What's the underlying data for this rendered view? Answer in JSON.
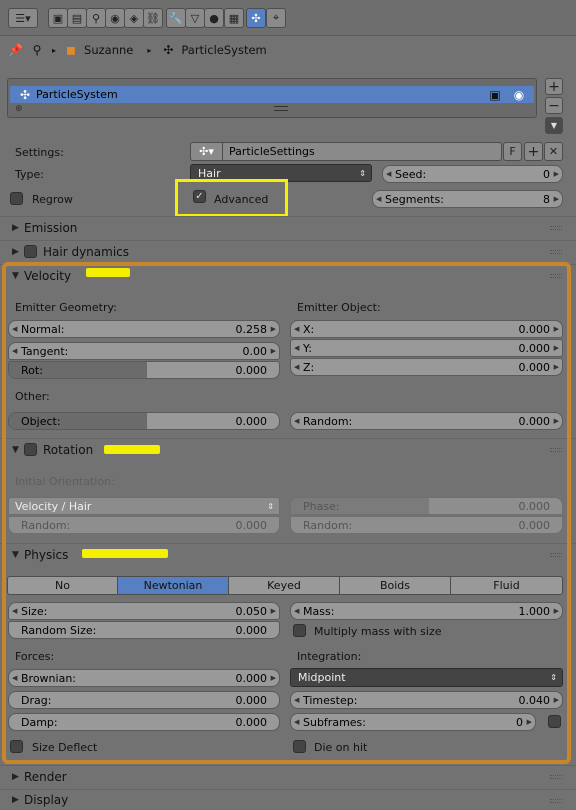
{
  "breadcrumb": {
    "object": "Suzanne",
    "particles": "ParticleSystem"
  },
  "list": {
    "item": "ParticleSystem",
    "add_symbol": "+",
    "remove_symbol": "−",
    "down_symbol": "▼"
  },
  "settings": {
    "label": "Settings:",
    "name": "ParticleSettings",
    "fake_user": "F",
    "type_label": "Type:",
    "type_value": "Hair",
    "seed_label": "Seed:",
    "seed_value": "0",
    "regrow_label": "Regrow",
    "advanced_label": "Advanced",
    "segments_label": "Segments:",
    "segments_value": "8"
  },
  "sections": {
    "emission": "Emission",
    "hair_dynamics": "Hair dynamics",
    "velocity": "Velocity",
    "rotation": "Rotation",
    "physics": "Physics",
    "render": "Render",
    "display": "Display"
  },
  "velocity": {
    "emitter_geometry": "Emitter Geometry:",
    "emitter_object": "Emitter Object:",
    "normal_label": "Normal:",
    "normal_value": "0.258",
    "tangent_label": "Tangent:",
    "tangent_value": "0.00",
    "rot_label": "Rot:",
    "rot_value": "0.000",
    "x_label": "X:",
    "x_value": "0.000",
    "y_label": "Y:",
    "y_value": "0.000",
    "z_label": "Z:",
    "z_value": "0.000",
    "other": "Other:",
    "object_label": "Object:",
    "object_value": "0.000",
    "random_label": "Random:",
    "random_value": "0.000"
  },
  "rotation": {
    "initial_orientation": "Initial Orientation:",
    "orientation_value": "Velocity / Hair",
    "random_label": "Random:",
    "random_value": "0.000",
    "phase_label": "Phase:",
    "phase_value": "0.000",
    "phase_random_label": "Random:",
    "phase_random_value": "0.000"
  },
  "physics": {
    "tabs": [
      "No",
      "Newtonian",
      "Keyed",
      "Boids",
      "Fluid"
    ],
    "size_label": "Size:",
    "size_value": "0.050",
    "random_size_label": "Random Size:",
    "random_size_value": "0.000",
    "mass_label": "Mass:",
    "mass_value": "1.000",
    "multiply_mass_label": "Multiply mass with size",
    "forces": "Forces:",
    "integration": "Integration:",
    "brownian_label": "Brownian:",
    "brownian_value": "0.000",
    "drag_label": "Drag:",
    "drag_value": "0.000",
    "damp_label": "Damp:",
    "damp_value": "0.000",
    "integrator_value": "Midpoint",
    "timestep_label": "Timestep:",
    "timestep_value": "0.040",
    "subframes_label": "Subframes:",
    "subframes_value": "0",
    "size_deflect_label": "Size Deflect",
    "die_on_hit_label": "Die on hit"
  },
  "colors": {
    "selection": "#5680c2",
    "annotation_box": "#f4f000",
    "annotation_outline": "#c8862a",
    "panel_bg": "#727272"
  }
}
